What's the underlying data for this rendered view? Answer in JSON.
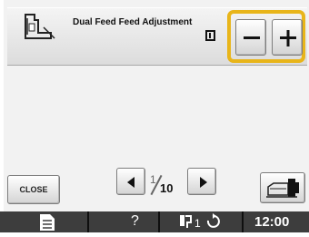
{
  "setting": {
    "title": "Dual Feed Feed Adjustment",
    "icon": "dual-feed-foot-icon",
    "value_icon": "feed-value-indicator-icon"
  },
  "controls": {
    "minus_icon": "minus-icon",
    "plus_icon": "plus-icon"
  },
  "footer": {
    "close_label": "CLOSE",
    "page_current": "1",
    "page_total": "10",
    "prev_icon": "left-arrow-icon",
    "next_icon": "right-arrow-icon",
    "machine_icon": "sewing-machine-icon"
  },
  "status_bar": {
    "help": "?",
    "time": "12:00",
    "icons": [
      "document-icon",
      "thread-bobbin-icon",
      "rotate-icon"
    ]
  },
  "colors": {
    "highlight": "#e8b51a",
    "status_bar": "#3d3d3d",
    "screen_bg": "#f2f2f2"
  }
}
